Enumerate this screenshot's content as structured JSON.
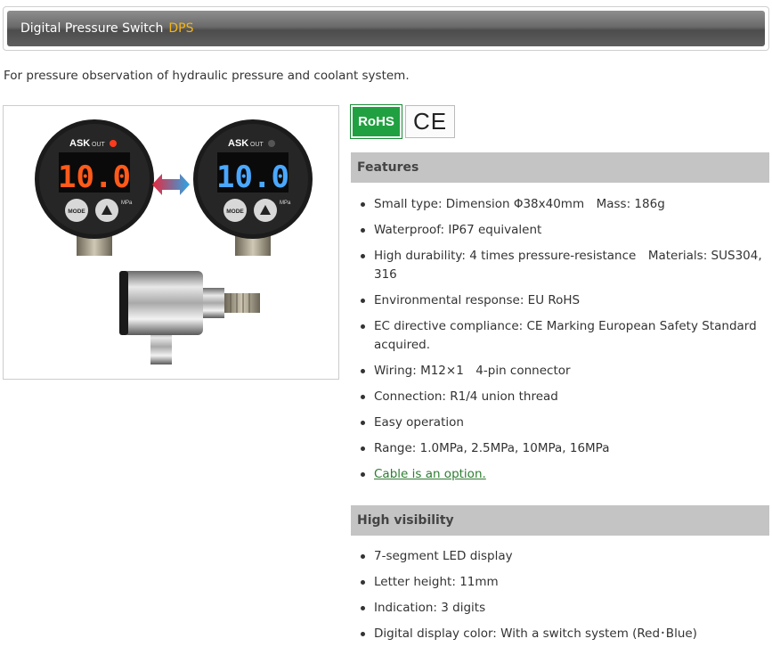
{
  "header": {
    "title": "Digital Pressure Switch",
    "title_accent": "DPS"
  },
  "intro": "For pressure observation of hydraulic pressure and coolant system.",
  "product_image": {
    "brand": "ASK",
    "out_label": "OUT",
    "display_value": "10.0",
    "mode_label": "MODE",
    "unit_label": "MPa",
    "display_colors": [
      "#ff5a1a",
      "#4aa8ff"
    ]
  },
  "certifications": {
    "rohs": "RoHS",
    "ce": "CE"
  },
  "features": {
    "heading": "Features",
    "items": [
      "Small type: Dimension Φ38x40mm　Mass: 186g",
      "Waterproof: IP67 equivalent",
      "High durability: 4 times pressure-resistance　Materials: SUS304, 316",
      "Environmental response: EU RoHS",
      "EC directive compliance: CE Marking European Safety Standard acquired.",
      "Wiring: M12×1　4-pin connector",
      "Connection: R1/4 union thread",
      "Easy operation",
      "Range: 1.0MPa, 2.5MPa, 10MPa, 16MPa"
    ],
    "link": "Cable is an option."
  },
  "visibility": {
    "heading": "High visibility",
    "items": [
      "7-segment LED display",
      "Letter height: 11mm",
      "Indication: 3 digits",
      "Digital display color: With a switch system (Red･Blue)"
    ]
  }
}
